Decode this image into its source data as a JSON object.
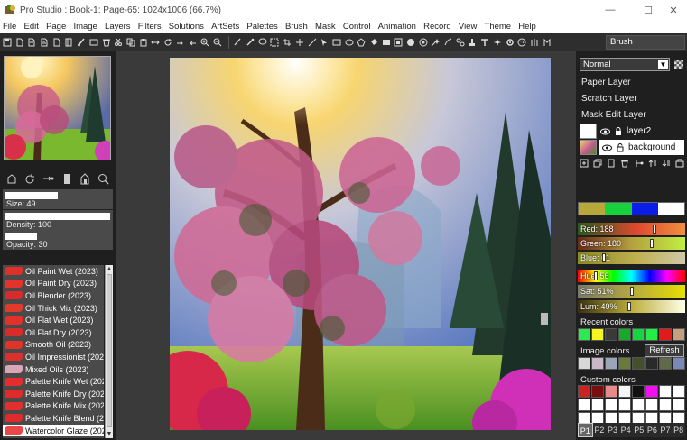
{
  "window": {
    "title": "Pro Studio : Book-1: Page-65: 1024x1006  (66.7%)",
    "minimize": "—",
    "maximize": "☐",
    "close": "✕"
  },
  "menu": [
    "File",
    "Edit",
    "Page",
    "Image",
    "Layers",
    "Filters",
    "Solutions",
    "ArtSets",
    "Palettes",
    "Brush",
    "Mask",
    "Control",
    "Animation",
    "Record",
    "View",
    "Theme",
    "Help"
  ],
  "toolbar": {
    "brush_label": "Brush"
  },
  "sliders": {
    "size": "Size: 49",
    "density": "Density: 100",
    "opacity": "Opacity: 30",
    "size_fill": 0.47,
    "density_fill": 1.0,
    "opacity_fill": 0.3
  },
  "brushes": [
    {
      "name": "Oil Paint Wet (2023)",
      "color": "#e0302a"
    },
    {
      "name": "Oil Paint Dry (2023)",
      "color": "#e3332b"
    },
    {
      "name": "Oil Blender (2023)",
      "color": "#d92a2e"
    },
    {
      "name": "Oil Thick Mix (2023)",
      "color": "#e23a2a"
    },
    {
      "name": "Oil Flat Wet (2023)",
      "color": "#e3302a"
    },
    {
      "name": "Oil Flat Dry (2023)",
      "color": "#d82c28"
    },
    {
      "name": "Smooth Oil (2023)",
      "color": "#e0332c"
    },
    {
      "name": "Oil Impressionist (202",
      "color": "#dc3030"
    },
    {
      "name": "Mixed Oils (2023)",
      "color": "#d9a5b8"
    },
    {
      "name": "Palette Knife Wet (202",
      "color": "#e52d2d"
    },
    {
      "name": "Palette Knife Dry (202",
      "color": "#e12b2b"
    },
    {
      "name": "Palette Knife Mix (202",
      "color": "#e3302e"
    },
    {
      "name": "Palette Knife Blend (2(",
      "color": "#de2c2c"
    },
    {
      "name": "Watercolor Glaze (202",
      "color": "#e84848"
    }
  ],
  "layers": {
    "blend_mode": "Normal",
    "items": [
      "Paper Layer",
      "Scratch Layer",
      "Mask Edit Layer"
    ],
    "layer2": "layer2",
    "background": "background"
  },
  "color": {
    "swatches": [
      "#b8a83a",
      "#17d23c",
      "#0b1de8",
      "#ffffff"
    ],
    "red": "Red: 188",
    "green": "Green: 180",
    "blue": "Blue: 61",
    "hue": "Hue: 56",
    "sat": "Sat: 51%",
    "lum": "Lum: 49%",
    "red_v": 188,
    "green_v": 180,
    "blue_v": 61,
    "hue_v": 56,
    "sat_v": 51,
    "lum_v": 49
  },
  "recent": {
    "label": "Recent colors",
    "colors": [
      "#2fe84f",
      "#f5f520",
      "#3a3a3a",
      "#17a92b",
      "#15d640",
      "#22ee44",
      "#e11b1b",
      "#c4a080"
    ]
  },
  "image": {
    "label": "Image colors",
    "refresh": "Refresh",
    "colors": [
      "#d8d8d8",
      "#c8b8c8",
      "#9aa6b8",
      "#6a7a3a",
      "#454f2a",
      "#2a2a2a",
      "#606a4a",
      "#7a8ab8"
    ]
  },
  "custom": {
    "label": "Custom colors",
    "colors": [
      "#cc2222",
      "#7a0e0e",
      "#e88a8a",
      "#f5f5f5",
      "#111111",
      "#ee11ee",
      "#ffffff",
      "#ffffff",
      "#ffffff",
      "#ffffff",
      "#ffffff",
      "#ffffff",
      "#ffffff",
      "#ffffff",
      "#ffffff",
      "#ffffff",
      "#ffffff",
      "#ffffff",
      "#ffffff",
      "#ffffff",
      "#ffffff",
      "#ffffff",
      "#ffffff",
      "#ffffff"
    ]
  },
  "palette_tabs": [
    "P1",
    "P2",
    "P3",
    "P4",
    "P5",
    "P6",
    "P7",
    "P8"
  ]
}
